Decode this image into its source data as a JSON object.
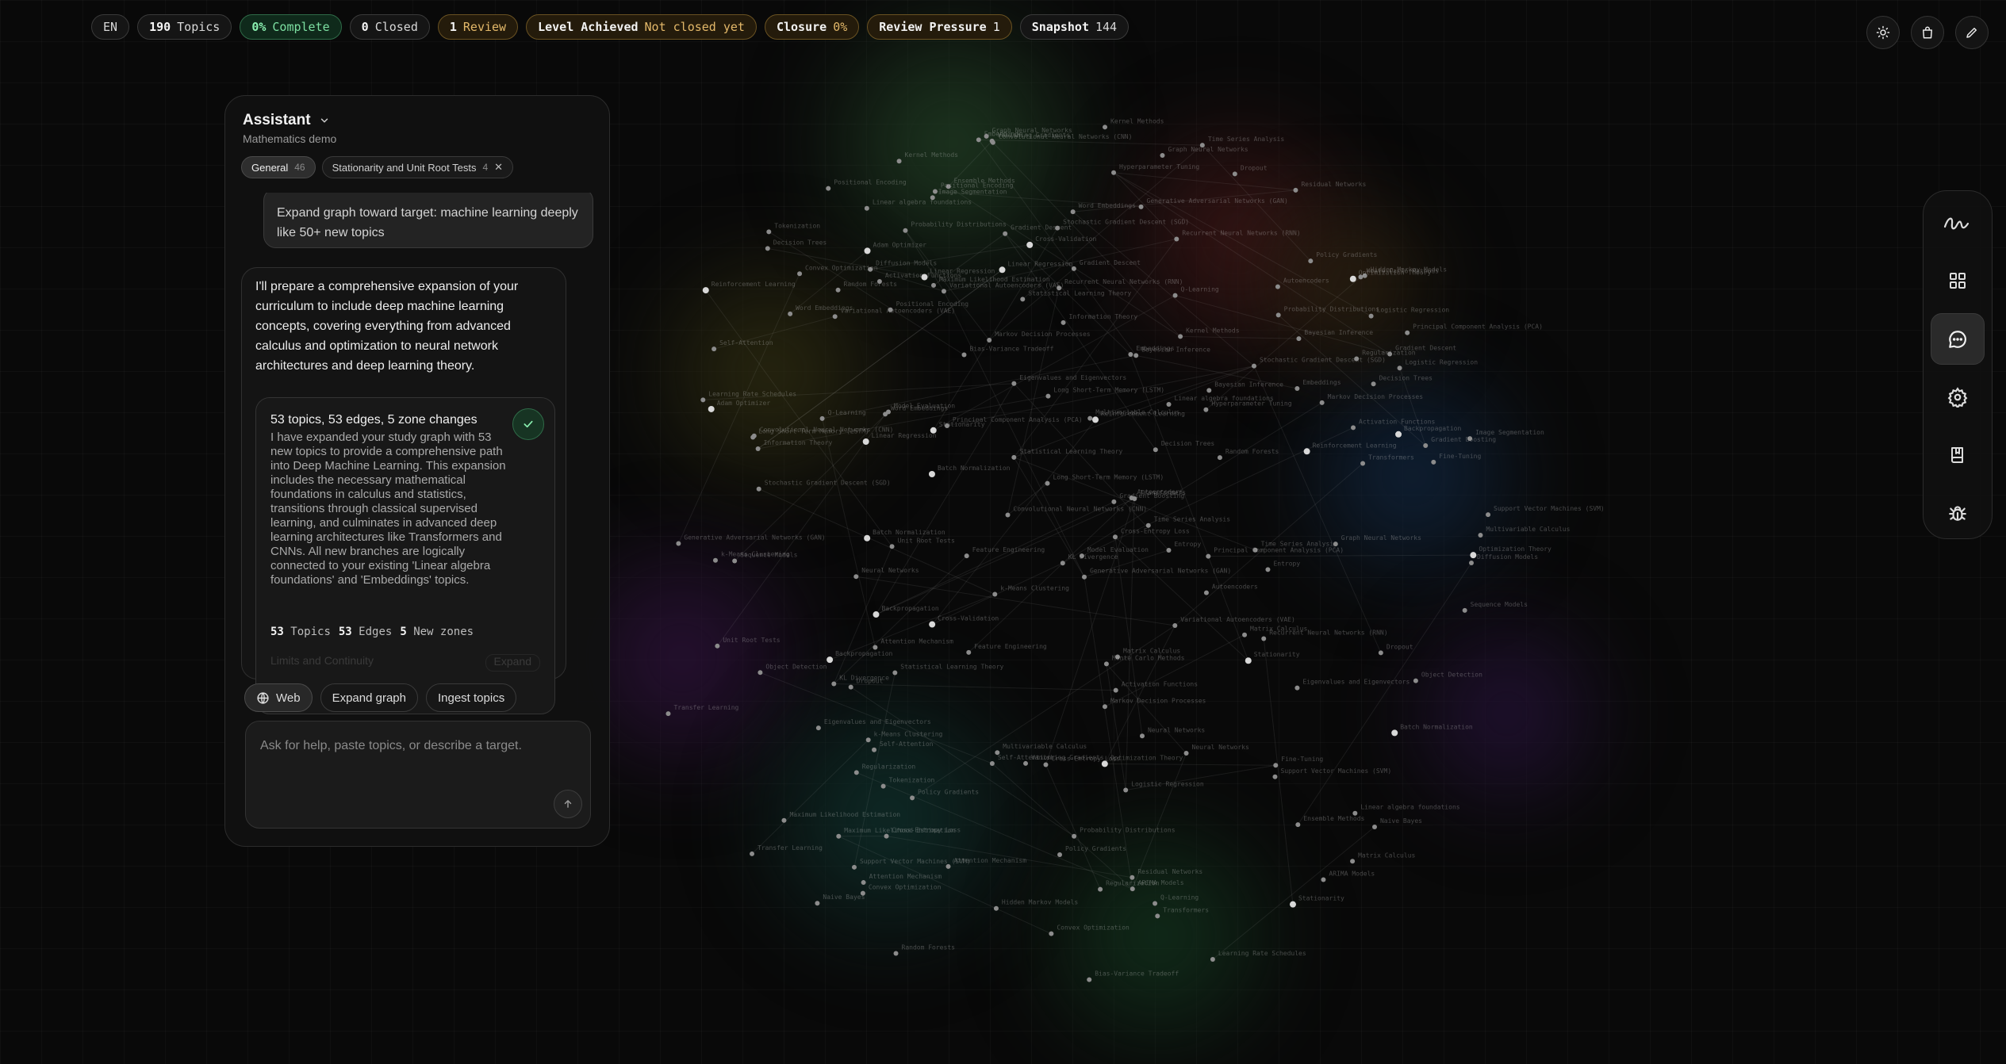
{
  "topbar": {
    "lang": "EN",
    "topics_count": "190",
    "topics_label": "Topics",
    "complete_value": "0%",
    "complete_label": "Complete",
    "closed_count": "0",
    "closed_label": "Closed",
    "review_count": "1",
    "review_label": "Review",
    "level_label": "Level Achieved",
    "level_value": "Not closed yet",
    "closure_label": "Closure",
    "closure_value": "0%",
    "pressure_label": "Review Pressure",
    "pressure_value": "1",
    "snapshot_label": "Snapshot",
    "snapshot_value": "144"
  },
  "topright_buttons": [
    "sun-icon",
    "bag-icon",
    "pencil-icon"
  ],
  "rail": {
    "items": [
      {
        "icon": "scribble-icon",
        "active": false
      },
      {
        "icon": "grid-icon",
        "active": false
      },
      {
        "icon": "chat-icon",
        "active": true
      },
      {
        "icon": "gear-icon",
        "active": false
      },
      {
        "icon": "book-icon",
        "active": false
      },
      {
        "icon": "bug-icon",
        "active": false
      }
    ]
  },
  "panel": {
    "title": "Assistant",
    "subtitle": "Mathematics demo",
    "chips": [
      {
        "label": "General",
        "count": "46",
        "selected": true
      },
      {
        "label": "Stationarity and Unit Root Tests",
        "count": "4",
        "closable": true
      }
    ],
    "user_message": "Expand graph toward target: machine learning deeply like 50+ new topics",
    "assistant_message": "I'll prepare a comprehensive expansion of your curriculum to include deep machine learning concepts, covering everything from advanced calculus and optimization to neural network architectures and deep learning theory.",
    "result": {
      "heading": "53 topics, 53 edges, 5 zone changes",
      "body": "I have expanded your study graph with 53 new topics to provide a comprehensive path into Deep Machine Learning. This expansion includes the necessary mathematical foundations in calculus and statistics, transitions through classical supervised learning, and culminates in advanced deep learning architectures like Transformers and CNNs. All new branches are logically connected to your existing 'Linear algebra foundations' and 'Embeddings' topics.",
      "topics_n": "53",
      "topics_l": "Topics",
      "edges_n": "53",
      "edges_l": "Edges",
      "zones_n": "5",
      "zones_l": "New zones",
      "faded_left": "Limits and Continuity",
      "faded_right": "Expand"
    },
    "actions": [
      "Web",
      "Expand graph",
      "Ingest topics"
    ],
    "composer_placeholder": "Ask for help, paste topics, or describe a target."
  },
  "graph": {
    "zones": [
      {
        "color": "#1f3a22"
      },
      {
        "color": "#3a1616"
      },
      {
        "color": "#2c2a10"
      },
      {
        "color": "#10233a"
      },
      {
        "color": "#2a1136"
      },
      {
        "color": "#0f2e2a"
      },
      {
        "color": "#221133"
      },
      {
        "color": "#12301c"
      },
      {
        "color": "#2a2010"
      }
    ],
    "labels": [
      "Optimization Theory",
      "Multivariable Calculus",
      "Gradient Descent",
      "Convex Optimization",
      "Stochastic Gradient Descent (SGD)",
      "Probability Distributions",
      "Bayesian Inference",
      "Maximum Likelihood Estimation",
      "Statistical Learning Theory",
      "Linear Regression",
      "Logistic Regression",
      "Support Vector Machines (SVM)",
      "Decision Trees",
      "Random Forests",
      "Principal Component Analysis (PCA)",
      "k-Means Clustering",
      "Kernel Methods",
      "Neural Networks",
      "Backpropagation",
      "Activation Functions",
      "Convolutional Neural Networks (CNN)",
      "Recurrent Neural Networks (RNN)",
      "Long Short-Term Memory (LSTM)",
      "Attention Mechanism",
      "Transformers",
      "Self-Attention",
      "Positional Encoding",
      "Batch Normalization",
      "Dropout",
      "Regularization",
      "Cross-Entropy Loss",
      "Word Embeddings",
      "Embeddings",
      "Autoencoders",
      "Variational Autoencoders (VAE)",
      "Generative Adversarial Networks (GAN)",
      "Reinforcement Learning",
      "Markov Decision Processes",
      "Q-Learning",
      "Policy Gradients",
      "Graph Neural Networks",
      "Linear algebra foundations",
      "Eigenvalues and Eigenvectors",
      "Matrix Calculus",
      "Time Series Analysis",
      "Stationarity",
      "Unit Root Tests",
      "ARIMA Models",
      "Monte Carlo Methods",
      "Hidden Markov Models",
      "Information Theory",
      "Entropy",
      "KL Divergence",
      "Model Evaluation",
      "Cross-Validation",
      "Bias-Variance Tradeoff",
      "Hyperparameter Tuning",
      "Transfer Learning",
      "Fine-Tuning",
      "Diffusion Models",
      "Tokenization",
      "Sequence Models",
      "Learning Rate Schedules",
      "Adam Optimizer",
      "Vanishing Gradients",
      "Residual Networks",
      "Object Detection",
      "Image Segmentation",
      "Feature Engineering",
      "Naive Bayes",
      "Ensemble Methods",
      "Gradient Boosting"
    ]
  }
}
